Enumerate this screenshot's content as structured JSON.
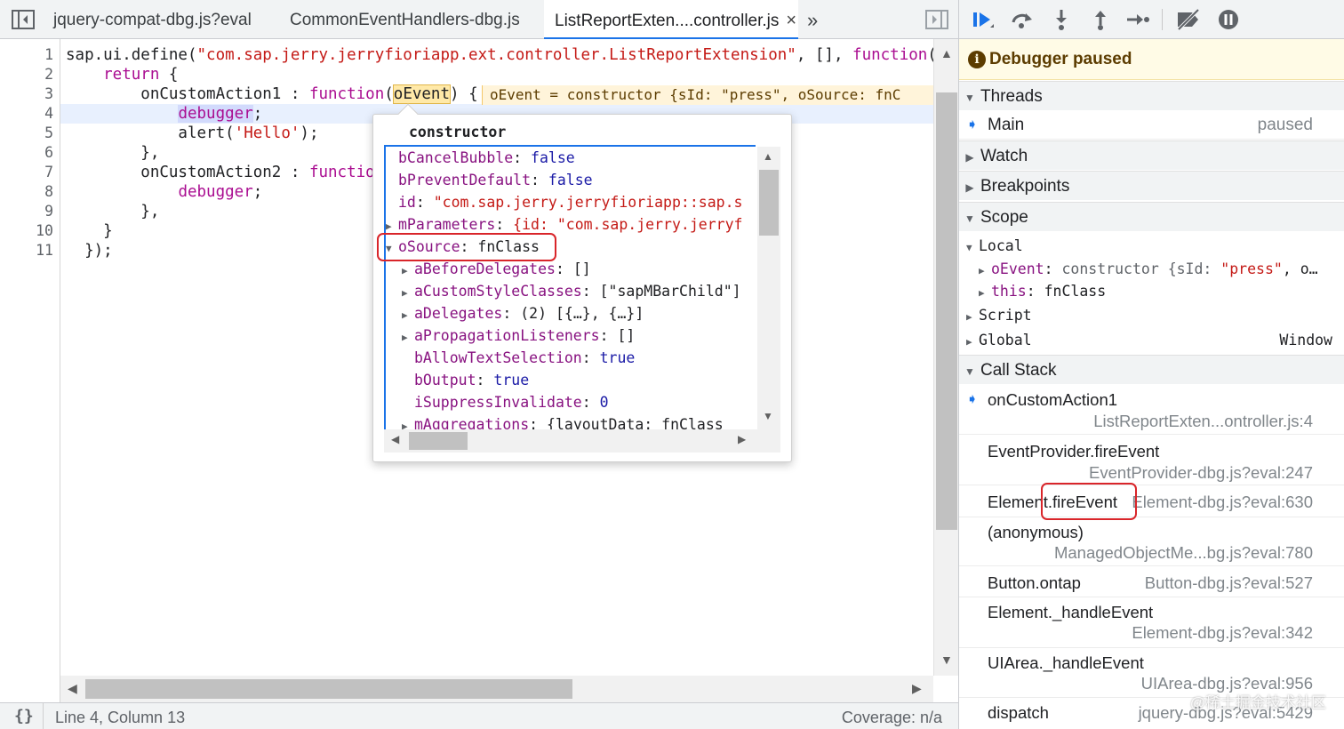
{
  "tabs": [
    {
      "label": "jquery-compat-dbg.js?eval"
    },
    {
      "label": "CommonEventHandlers-dbg.js"
    },
    {
      "label": "ListReportExten....controller.js",
      "close": "×"
    }
  ],
  "tab_overflow": "»",
  "line_numbers": [
    "1",
    "2",
    "3",
    "4",
    "5",
    "6",
    "7",
    "8",
    "9",
    "10",
    "11"
  ],
  "code": {
    "l1_a": "sap.ui.define(",
    "l1_str": "\"com.sap.jerry.jerryfioriapp.ext.controller.ListReportExtension\"",
    "l1_b": ", [], ",
    "l1_kw": "function",
    "l1_c": "()",
    "l2_kw": "    return",
    "l2_b": " {",
    "l3_a": "        onCustomAction1 : ",
    "l3_kw": "function",
    "l3_p": "(",
    "l3_param": "oEvent",
    "l3_b": ") {",
    "l3_inline": "oEvent = constructor {sId: \"press\", oSource: fnC",
    "l4_pre": "            ",
    "l4_kw": "debugger",
    "l4_b": ";",
    "l5_a": "            alert(",
    "l5_str": "'Hello'",
    "l5_b": ");",
    "l6": "        },",
    "l7_a": "        onCustomAction2 : ",
    "l7_kw": "function",
    "l8_pre": "            ",
    "l8_kw": "debugger",
    "l8_b": ";",
    "l9": "        },",
    "l10": "    }",
    "l11": "  });"
  },
  "status": {
    "position": "Line 4, Column 13",
    "coverage": "Coverage: n/a",
    "format_label": "{}"
  },
  "popover": {
    "title": "constructor",
    "rows": [
      {
        "key": "bCancelBubble",
        "sep": ": ",
        "val": "false",
        "kind": "b",
        "expand": false
      },
      {
        "key": "bPreventDefault",
        "sep": ": ",
        "val": "false",
        "kind": "b",
        "expand": false
      },
      {
        "key": "id",
        "sep": ": ",
        "val": "\"com.sap.jerry.jerryfioriapp::sap.s",
        "kind": "s",
        "expand": false
      },
      {
        "key": "mParameters",
        "sep": ": ",
        "val": "{id: \"com.sap.jerry.jerryf",
        "kind": "s",
        "expand": true
      },
      {
        "key": "oSource",
        "sep": ": ",
        "val": "fnClass",
        "kind": "d",
        "expand": true
      },
      {
        "key": "aBeforeDelegates",
        "sep": ": ",
        "val": "[]",
        "kind": "d",
        "expand": true
      },
      {
        "key": "aCustomStyleClasses",
        "sep": ": ",
        "val": "[\"sapMBarChild\"]",
        "kind": "d",
        "expand": true
      },
      {
        "key": "aDelegates",
        "sep": ": ",
        "val": "(2) [{…}, {…}]",
        "kind": "d",
        "expand": true
      },
      {
        "key": "aPropagationListeners",
        "sep": ": ",
        "val": "[]",
        "kind": "d",
        "expand": true
      },
      {
        "key": "bAllowTextSelection",
        "sep": ": ",
        "val": "true",
        "kind": "b",
        "expand": false
      },
      {
        "key": "bOutput",
        "sep": ": ",
        "val": "true",
        "kind": "b",
        "expand": false
      },
      {
        "key": "iSuppressInvalidate",
        "sep": ": ",
        "val": "0",
        "kind": "b",
        "expand": false
      },
      {
        "key": "mAggregations",
        "sep": ": ",
        "val": "{layoutData: fnClass",
        "kind": "d",
        "expand": true
      }
    ]
  },
  "debugger": {
    "paused_label": "Debugger paused",
    "threads_label": "Threads",
    "thread_main": "Main",
    "thread_status": "paused",
    "watch_label": "Watch",
    "breakpoints_label": "Breakpoints",
    "scope_label": "Scope",
    "local_label": "Local",
    "local_oevent_key": "oEvent",
    "local_oevent_val": "constructor {sId: ",
    "local_oevent_str": "\"press\"",
    "local_oevent_tail": ", o…",
    "local_this_key": "this",
    "local_this_val": "fnClass",
    "script_label": "Script",
    "global_label": "Global",
    "global_val": "Window",
    "callstack_label": "Call Stack",
    "frames": [
      {
        "fn": "onCustomAction1",
        "loc": "ListReportExten...ontroller.js:4"
      },
      {
        "fn": "EventProvider.fireEvent",
        "loc": "EventProvider-dbg.js?eval:247"
      },
      {
        "fn": "Element.fireEvent",
        "loc": "Element-dbg.js?eval:630"
      },
      {
        "fn": "(anonymous)",
        "loc": "ManagedObjectMe...bg.js?eval:780"
      },
      {
        "fn": "Button.ontap",
        "loc": "Button-dbg.js?eval:527"
      },
      {
        "fn": "Element._handleEvent",
        "loc": "Element-dbg.js?eval:342"
      },
      {
        "fn": "UIArea._handleEvent",
        "loc": "UIArea-dbg.js?eval:956"
      },
      {
        "fn": "dispatch",
        "loc": "jquery-dbg.js?eval:5429"
      }
    ]
  },
  "watermark": "@稀土掘金技术社区",
  "colors": {
    "accent": "#1a73e8",
    "annotation": "#d9252a",
    "keyword": "#aa0d91",
    "string": "#c41a16"
  }
}
